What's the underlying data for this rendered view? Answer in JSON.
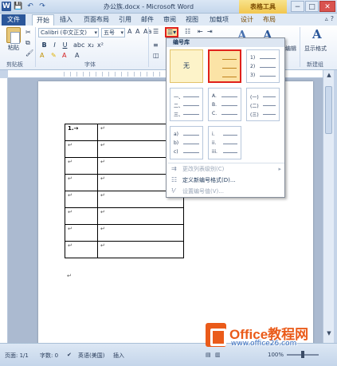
{
  "window": {
    "title": "办公族.docx - Microsoft Word",
    "context_tab_group": "表格工具",
    "buttons": {
      "minimize": "−",
      "maximize": "□",
      "close": "✕"
    }
  },
  "qat": {
    "word_logo": "W",
    "save": "💾",
    "undo": "↶",
    "redo": "↷"
  },
  "tabs": [
    {
      "label": "文件"
    },
    {
      "label": "开始"
    },
    {
      "label": "插入"
    },
    {
      "label": "页面布局"
    },
    {
      "label": "引用"
    },
    {
      "label": "邮件"
    },
    {
      "label": "审阅"
    },
    {
      "label": "视图"
    },
    {
      "label": "加载项"
    },
    {
      "label": "设计"
    },
    {
      "label": "布局"
    }
  ],
  "ribbon": {
    "paste_label": "粘贴",
    "clipboard_group": "剪贴板",
    "font_group": "字体",
    "font_name": "Calibri (中文正文)",
    "font_size": "五号",
    "bold": "B",
    "italic": "I",
    "underline": "U",
    "styles_label": "编辑",
    "show_format_label": "显示格式",
    "new_group_label": "新建组",
    "style_glyph": "A"
  },
  "dropdown": {
    "header": "编号库",
    "none_label": "无",
    "tiles": [
      {
        "lines": [
          "1.",
          "2.",
          "3."
        ]
      },
      {
        "lines": [
          "1)",
          "2)",
          "3)"
        ]
      },
      {
        "lines": [
          "一、",
          "二、",
          "三、"
        ]
      },
      {
        "lines": [
          "A.",
          "B.",
          "C."
        ]
      },
      {
        "lines": [
          "(一)",
          "(二)",
          "(三)"
        ]
      },
      {
        "lines": [
          "a)",
          "b)",
          "c)"
        ]
      },
      {
        "lines": [
          "i.",
          "ii.",
          "iii."
        ]
      }
    ],
    "menu": [
      {
        "label": "更改列表级别(C)",
        "disabled": true
      },
      {
        "label": "定义新编号格式(D)...",
        "disabled": false
      },
      {
        "label": "设置编号值(V)...",
        "disabled": true
      }
    ]
  },
  "document": {
    "first_cell": "1.→",
    "cell_mark": "↵"
  },
  "status": {
    "page": "页面: 1/1",
    "words": "字数: 0",
    "language": "英语(美国)",
    "mode": "插入",
    "zoom": "100%"
  },
  "watermark": {
    "title": "Office教程网",
    "url": "www.office26.com"
  }
}
